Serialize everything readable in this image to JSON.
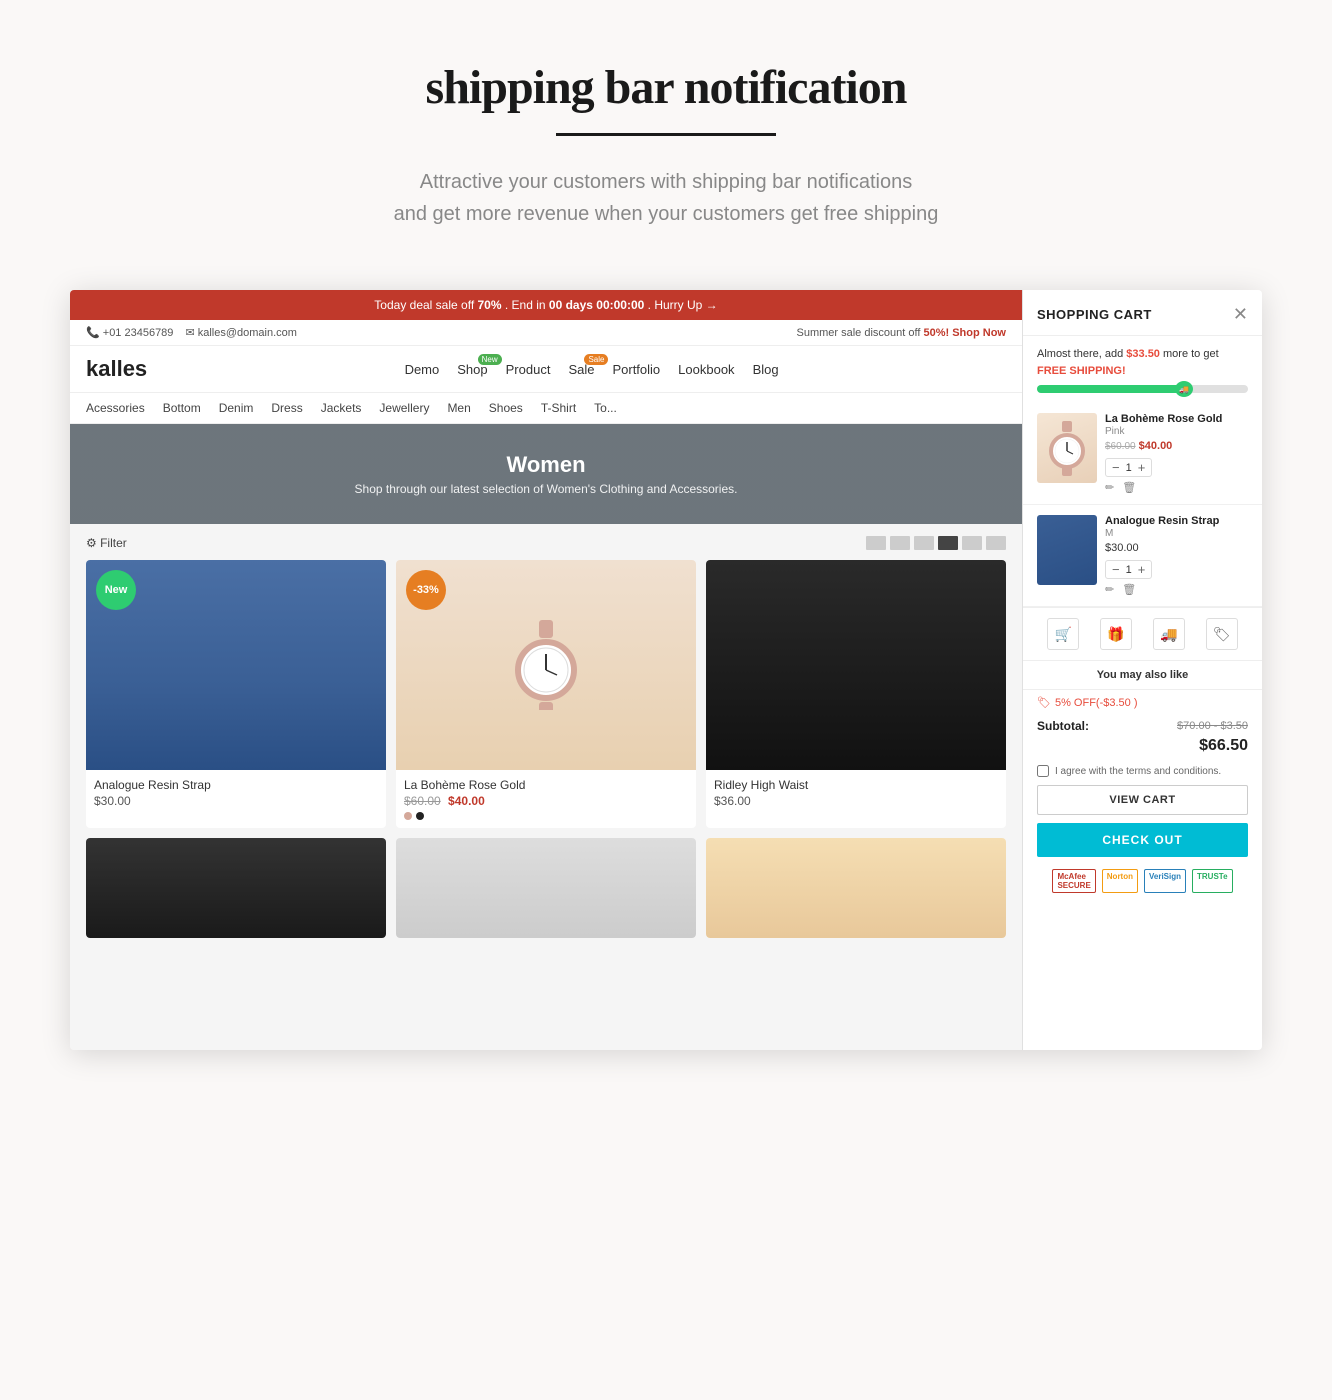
{
  "page": {
    "title": "shipping bar notification",
    "underline": true,
    "subtitle_line1": "Attractive your customers with shipping bar notifications",
    "subtitle_line2": "and get more revenue when your customers get free shipping"
  },
  "store": {
    "deal_bar": {
      "text_before": "Today deal sale off",
      "percentage": "70%",
      "text_mid": ". End in",
      "countdown": "00 days 00:00:00",
      "text_end": ". Hurry Up →"
    },
    "info_bar": {
      "phone": "+01 23456789",
      "email": "kalles@domain.com",
      "sale_text": "Summer sale discount off",
      "sale_pct": "50%!",
      "shop_now": "Shop Now"
    },
    "logo": "kalles",
    "nav_items": [
      {
        "label": "Demo"
      },
      {
        "label": "Shop",
        "badge": "New",
        "badge_type": "green"
      },
      {
        "label": "Product"
      },
      {
        "label": "Sale",
        "badge": "Sale",
        "badge_type": "orange"
      },
      {
        "label": "Portfolio"
      },
      {
        "label": "Lookbook"
      },
      {
        "label": "Blog"
      }
    ],
    "categories": [
      "Acessories",
      "Bottom",
      "Denim",
      "Dress",
      "Jackets",
      "Jewellery",
      "Men",
      "Shoes",
      "T-Shirt",
      "To..."
    ],
    "hero": {
      "title": "Women",
      "subtitle": "Shop through our latest selection of Women's Clothing and Accessories."
    },
    "products": [
      {
        "name": "Analogue Resin Strap",
        "price": "$30.00",
        "badge": "New",
        "badge_type": "green",
        "img_type": "pants-blue"
      },
      {
        "name": "La Bohème Rose Gold",
        "price_old": "$60.00",
        "price_new": "$40.00",
        "badge": "-33%",
        "badge_type": "discount",
        "img_type": "watch-pink",
        "dots": [
          "#d4a89a",
          "#222"
        ]
      },
      {
        "name": "Ridley High Waist",
        "price": "$36.00",
        "img_type": "pants-black"
      }
    ],
    "products_row2": [
      {
        "img_type": "row2-left"
      },
      {
        "img_type": "row2-mid"
      },
      {
        "img_type": "row2-right"
      }
    ]
  },
  "cart": {
    "title": "SHOPPING CART",
    "shipping_notice": "Almost there, add",
    "shipping_amount": "$33.50",
    "shipping_text_after": "more to get",
    "shipping_free": "FREE SHIPPING!",
    "progress_pct": 70,
    "items": [
      {
        "name": "La Bohème Rose Gold",
        "variant": "Pink",
        "price_old": "$60.00",
        "price_cur": "$40.00",
        "qty": 1,
        "img_type": "watch"
      },
      {
        "name": "Analogue Resin Strap",
        "variant": "M",
        "price": "$30.00",
        "qty": 1,
        "img_type": "pants"
      }
    ],
    "discount_label": "5% OFF(-$3.50 )",
    "subtotal_label": "Subtotal:",
    "subtotal_orig": "$70.00 - $3.50",
    "subtotal_final": "$66.50",
    "terms_text": "I agree with the terms and conditions.",
    "view_cart_label": "VIEW CART",
    "checkout_label": "CHECK OUT",
    "badges": [
      "McAfee SECURE",
      "Norton",
      "VeriSign",
      "TRUSTe"
    ],
    "action_icons": [
      "cart-icon",
      "gift-icon",
      "truck-icon",
      "tag-icon"
    ],
    "also_like_label": "You may also like"
  }
}
